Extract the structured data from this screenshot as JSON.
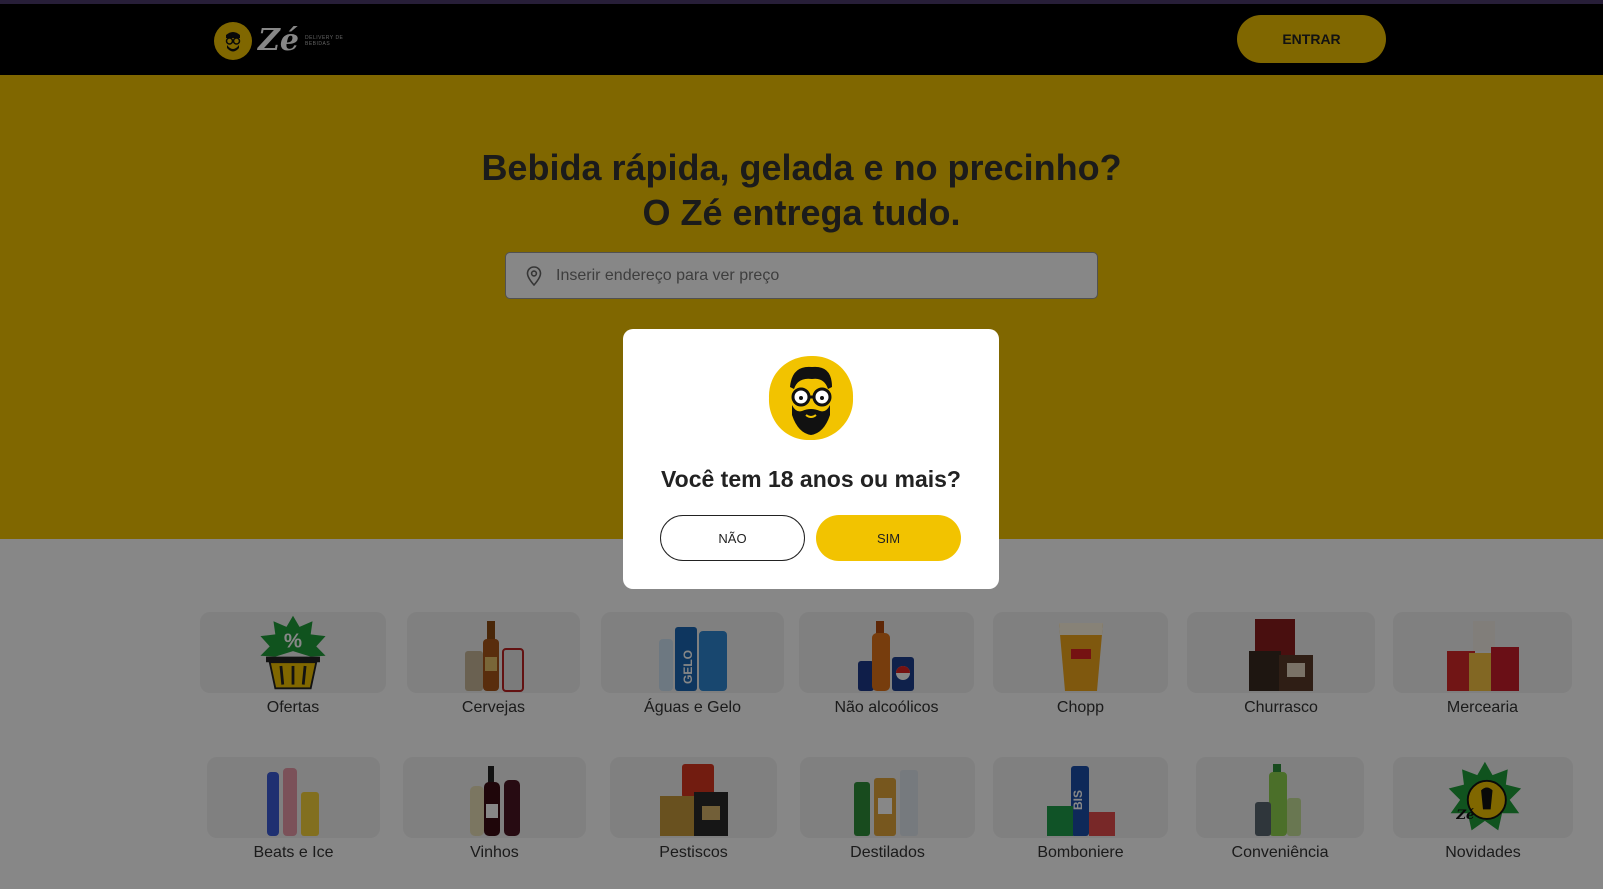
{
  "header": {
    "logo_text": "Zé",
    "logo_sub": "DELIVERY DE BEBIDAS",
    "enter_label": "ENTRAR"
  },
  "hero": {
    "title_line1": "Bebida rápida, gelada e no precinho?",
    "title_line2": "O Zé entrega tudo.",
    "search_placeholder": "Inserir endereço para ver preço"
  },
  "categories": [
    {
      "label": "Ofertas",
      "icon": "offers-basket-icon"
    },
    {
      "label": "Cervejas",
      "icon": "beer-bottles-icon"
    },
    {
      "label": "Águas e Gelo",
      "icon": "water-ice-icon"
    },
    {
      "label": "Não alcoólicos",
      "icon": "soft-drinks-icon"
    },
    {
      "label": "Chopp",
      "icon": "draft-beer-glass-icon"
    },
    {
      "label": "Churrasco",
      "icon": "barbecue-icon"
    },
    {
      "label": "Mercearia",
      "icon": "grocery-icon"
    },
    {
      "label": "Beats e Ice",
      "icon": "beats-ice-icon"
    },
    {
      "label": "Vinhos",
      "icon": "wine-bottles-icon"
    },
    {
      "label": "Pestiscos",
      "icon": "snacks-icon"
    },
    {
      "label": "Destilados",
      "icon": "spirits-icon"
    },
    {
      "label": "Bomboniere",
      "icon": "candy-icon"
    },
    {
      "label": "Conveniência",
      "icon": "convenience-icon"
    },
    {
      "label": "Novidades",
      "icon": "news-badge-icon"
    }
  ],
  "modal": {
    "question": "Você tem 18 anos ou mais?",
    "no_label": "NÃO",
    "yes_label": "SIM"
  },
  "colors": {
    "brand_yellow": "#f2c300",
    "header_black": "#000000",
    "overlay": "rgba(0,0,0,0.47)"
  }
}
